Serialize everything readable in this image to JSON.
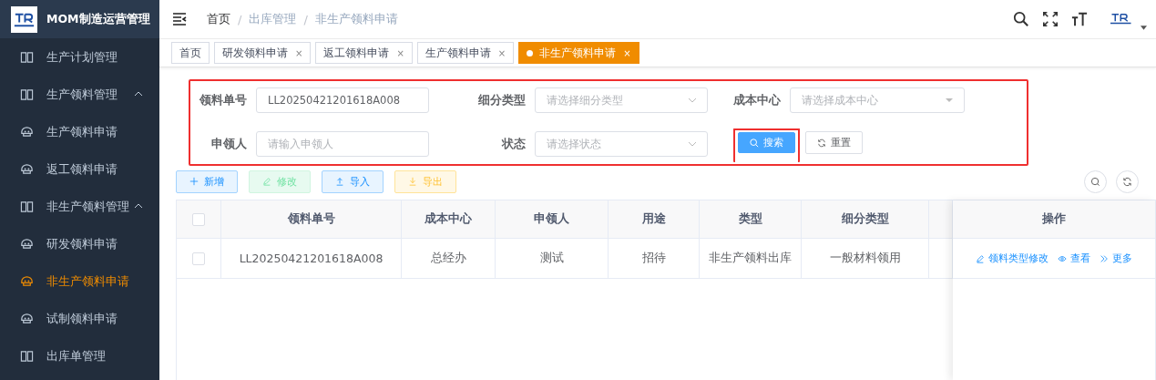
{
  "app": {
    "title": "MOM制造运营管理"
  },
  "sidebar": {
    "items": [
      {
        "kind": "group",
        "label": "生产计划管理",
        "expanded": false,
        "selected": false
      },
      {
        "kind": "group",
        "label": "生产领料管理",
        "expanded": true,
        "selected": false
      },
      {
        "kind": "leaf",
        "label": "生产领料申请",
        "selected": false
      },
      {
        "kind": "leaf",
        "label": "返工领料申请",
        "selected": false
      },
      {
        "kind": "group",
        "label": "非生产领料管理",
        "expanded": true,
        "selected": false
      },
      {
        "kind": "leaf",
        "label": "研发领料申请",
        "selected": false
      },
      {
        "kind": "leaf",
        "label": "非生产领料申请",
        "selected": true
      },
      {
        "kind": "leaf",
        "label": "试制领料申请",
        "selected": false
      },
      {
        "kind": "group",
        "label": "出库单管理",
        "expanded": false,
        "selected": false
      }
    ]
  },
  "breadcrumb": [
    "首页",
    "出库管理",
    "非生产领料申请"
  ],
  "breadcrumb_separator": "/",
  "tabs": [
    {
      "label": "首页",
      "closable": false,
      "selected": false
    },
    {
      "label": "研发领料申请",
      "closable": true,
      "selected": false
    },
    {
      "label": "返工领料申请",
      "closable": true,
      "selected": false
    },
    {
      "label": "生产领料申请",
      "closable": true,
      "selected": false
    },
    {
      "label": "非生产领料申请",
      "closable": true,
      "selected": true
    }
  ],
  "close_glyph": "×",
  "filters": [
    {
      "label": "领料单号",
      "kind": "input",
      "value": "LL20250421201618A008"
    },
    {
      "label": "细分类型",
      "kind": "select",
      "placeholder": "请选择细分类型"
    },
    {
      "label": "成本中心",
      "kind": "dropdown",
      "placeholder": "请选择成本中心"
    },
    {
      "label": "申领人",
      "kind": "input",
      "placeholder": "请输入申领人"
    },
    {
      "label": "状态",
      "kind": "select",
      "placeholder": "请选择状态"
    }
  ],
  "search_button": "搜索",
  "reset_button": "重置",
  "toolbar": [
    {
      "label": "新增",
      "kind": "add"
    },
    {
      "label": "修改",
      "kind": "edit"
    },
    {
      "label": "导入",
      "kind": "import"
    },
    {
      "label": "导出",
      "kind": "export"
    }
  ],
  "table": {
    "all_checked": false,
    "columns": [
      "领料单号",
      "成本中心",
      "申领人",
      "用途",
      "类型",
      "细分类型"
    ],
    "action_column": "操作",
    "rows": [
      {
        "checked": false,
        "cells": [
          "LL20250421201618A008",
          "总经办",
          "测试",
          "招待",
          "非生产领料出库",
          "一般材料领用"
        ],
        "actions": [
          {
            "kind": "edit",
            "label": "领料类型修改"
          },
          {
            "kind": "view",
            "label": "查看"
          },
          {
            "kind": "more",
            "label": "更多"
          }
        ]
      }
    ]
  }
}
